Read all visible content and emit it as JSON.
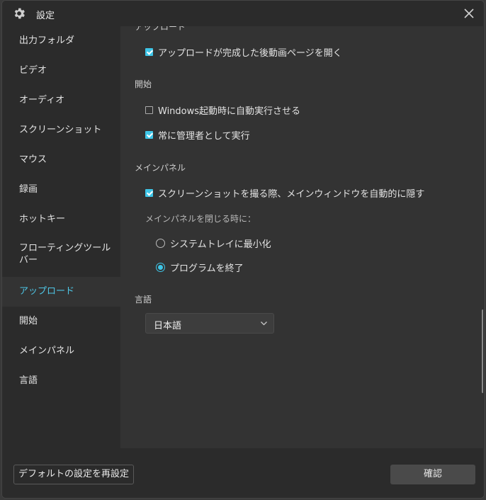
{
  "window": {
    "title": "設定"
  },
  "sidebar": {
    "items": [
      {
        "label": "出力フォルダ"
      },
      {
        "label": "ビデオ"
      },
      {
        "label": "オーディオ"
      },
      {
        "label": "スクリーンショット"
      },
      {
        "label": "マウス"
      },
      {
        "label": "録画"
      },
      {
        "label": "ホットキー"
      },
      {
        "label": "フローティングツールバー"
      },
      {
        "label": "アップロード",
        "active": true
      },
      {
        "label": "開始"
      },
      {
        "label": "メインパネル"
      },
      {
        "label": "言語"
      }
    ]
  },
  "content": {
    "upload": {
      "title_partial": "アップロード",
      "open_page": {
        "label": "アップロードが完成した後動画ページを開く",
        "checked": true
      }
    },
    "start": {
      "title": "開始",
      "auto_run": {
        "label": "Windows起動時に自動実行させる",
        "checked": false
      },
      "run_as_admin": {
        "label": "常に管理者として実行",
        "checked": true
      }
    },
    "main_panel": {
      "title": "メインパネル",
      "hide_on_capture": {
        "label": "スクリーンショットを撮る際、メインウィンドウを自動的に隠す",
        "checked": true
      },
      "on_close_label": "メインパネルを閉じる時に：",
      "options": [
        {
          "label": "システムトレイに最小化",
          "selected": false
        },
        {
          "label": "プログラムを終了",
          "selected": true
        }
      ]
    },
    "language": {
      "title": "言語",
      "selected": "日本語"
    }
  },
  "footer": {
    "reset_label": "デフォルトの設定を再設定",
    "ok_label": "確認"
  },
  "colors": {
    "accent": "#3ec6e8",
    "active_text": "#4ec6e6",
    "panel_bg": "#333333",
    "sidebar_bg": "#2b2b2b"
  },
  "icons": {
    "title": "gear-icon",
    "close": "close-icon",
    "dropdown": "chevron-down-icon"
  }
}
